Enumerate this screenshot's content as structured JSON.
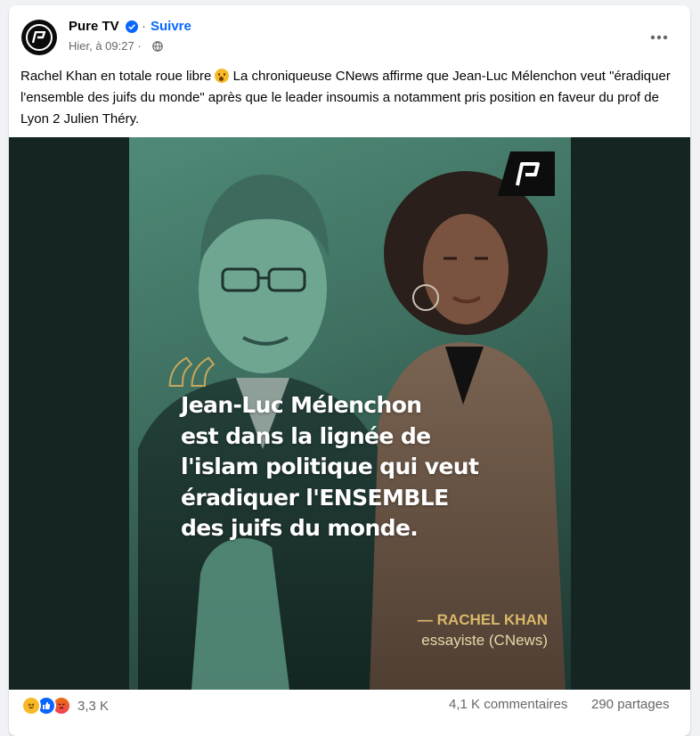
{
  "post": {
    "page_name": "Pure TV",
    "separator": "·",
    "follow_label": "Suivre",
    "timestamp": "Hier, à 09:27 ·",
    "text_before_emoji": "Rachel Khan en totale roue libre ",
    "text_after_emoji": " La chroniqueuse CNews affirme que Jean-Luc Mélenchon veut \"éradiquer l'ensemble des juifs du monde\" après que le leader insoumis a notamment pris position en faveur du prof de Lyon 2 Julien Théry.",
    "more_icon": "•••"
  },
  "image": {
    "quote_lines": [
      "Jean-Luc Mélenchon",
      "est dans la lignée de",
      "l'islam politique qui veut",
      "éradiquer l'ENSEMBLE",
      "des juifs du monde."
    ],
    "author": "— RACHEL KHAN",
    "author_role": "essayiste (CNews)"
  },
  "footer": {
    "reaction_count": "3,3 K",
    "comments": "4,1 K commentaires",
    "shares": "290 partages"
  },
  "colors": {
    "brand_blue": "#0866ff",
    "poster_green": "#4f8a78",
    "quote_gold": "#c7a75b"
  },
  "icons": {
    "verified": "verified-badge-icon",
    "globe": "globe-icon",
    "more": "more-options-icon",
    "reactions": [
      "haha-reaction-icon",
      "like-reaction-icon",
      "angry-reaction-icon"
    ]
  }
}
